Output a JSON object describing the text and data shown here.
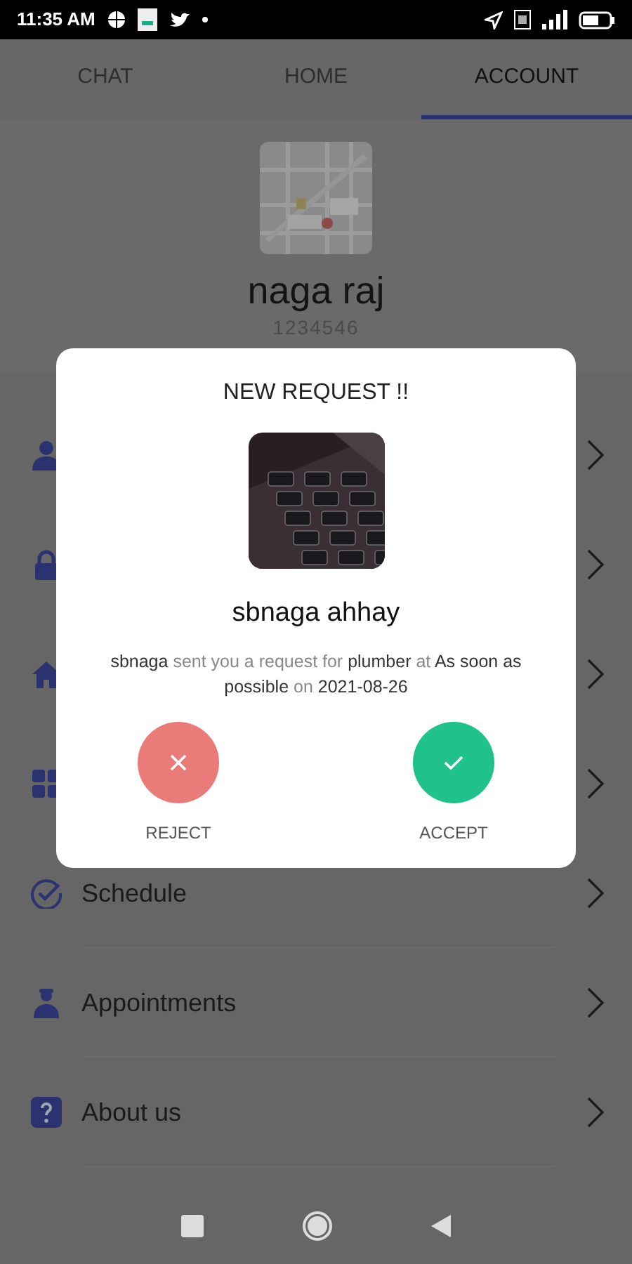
{
  "status_bar": {
    "time": "11:35 AM"
  },
  "tabs": [
    {
      "label": "CHAT",
      "selected": false
    },
    {
      "label": "HOME",
      "selected": false
    },
    {
      "label": "ACCOUNT",
      "selected": true
    }
  ],
  "profile": {
    "name": "naga raj",
    "phone": "1234546"
  },
  "menu": [
    {
      "kind": "covered"
    },
    {
      "kind": "covered"
    },
    {
      "kind": "covered"
    },
    {
      "kind": "covered"
    },
    {
      "kind": "item",
      "label": "Schedule"
    },
    {
      "kind": "item",
      "label": "Appointments"
    },
    {
      "kind": "item",
      "label": "About us"
    }
  ],
  "dialog": {
    "title": "NEW REQUEST !!",
    "sender_name": "sbnaga ahhay",
    "message": "**sbnaga** sent you a request for **plumber** at **As soon as possible** on **2021-08-26**",
    "buttons": [
      {
        "kind": "reject",
        "label": "REJECT"
      },
      {
        "kind": "accept",
        "label": "ACCEPT"
      }
    ]
  }
}
